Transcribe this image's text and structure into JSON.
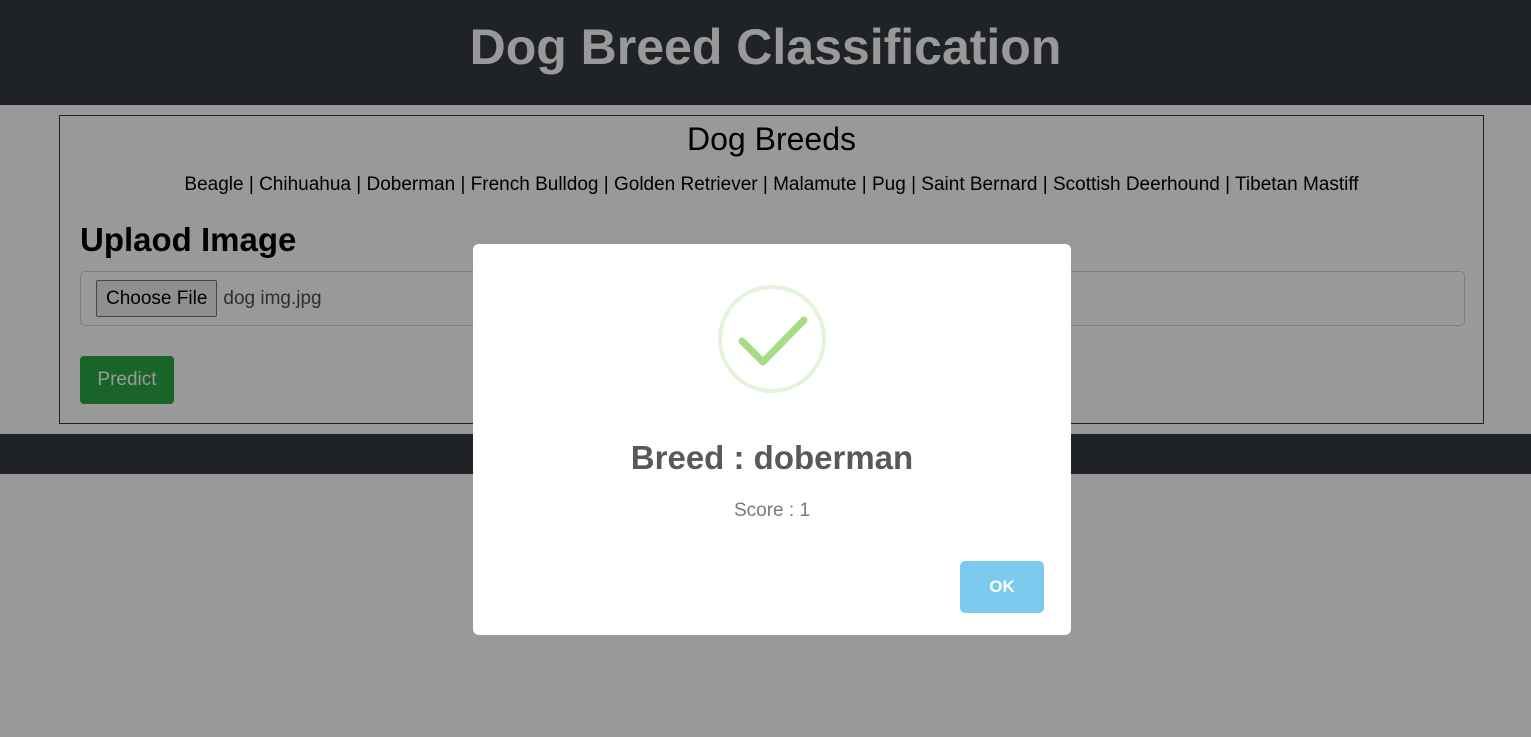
{
  "header": {
    "title": "Dog Breed Classification"
  },
  "breeds": {
    "title": "Dog Breeds",
    "list": "Beagle | Chihuahua | Doberman | French Bulldog | Golden Retriever | Malamute | Pug | Saint Bernard | Scottish Deerhound | Tibetan Mastiff"
  },
  "upload": {
    "title": "Uplaod Image",
    "choose_file_label": "Choose File",
    "file_name": "dog img.jpg",
    "predict_label": "Predict"
  },
  "modal": {
    "icon": "success-check-icon",
    "title": "Breed : doberman",
    "text": "Score : 1",
    "ok_label": "OK"
  },
  "colors": {
    "header_bg": "#343a40",
    "predict_btn": "#28a745",
    "ok_btn": "#7ccbef",
    "check": "#a5dc86"
  }
}
